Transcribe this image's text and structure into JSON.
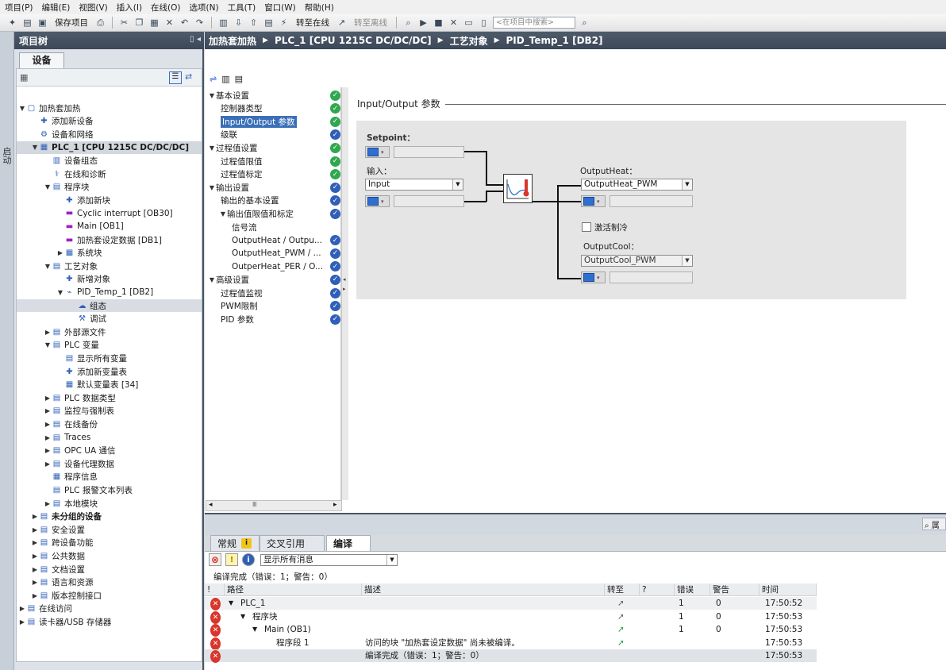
{
  "menu": [
    "项目(P)",
    "编辑(E)",
    "视图(V)",
    "插入(I)",
    "在线(O)",
    "选项(N)",
    "工具(T)",
    "窗口(W)",
    "帮助(H)"
  ],
  "toolbar": {
    "save_project": "保存项目",
    "go_online": "转至在线",
    "go_offline": "转至离线",
    "search_placeholder": "<在项目中搜索>"
  },
  "left_strip": "启动",
  "project_tree": {
    "title": "项目树",
    "devices_tab": "设备",
    "items": [
      {
        "label": "加热套加热",
        "depth": 0,
        "arrow": "down",
        "bold": false
      },
      {
        "label": "添加新设备",
        "depth": 1,
        "arrow": "",
        "bold": false
      },
      {
        "label": "设备和网络",
        "depth": 1,
        "arrow": "",
        "bold": false
      },
      {
        "label": "PLC_1 [CPU 1215C DC/DC/DC]",
        "depth": 1,
        "arrow": "down",
        "bold": true,
        "selected": true
      },
      {
        "label": "设备组态",
        "depth": 2,
        "arrow": "",
        "bold": false
      },
      {
        "label": "在线和诊断",
        "depth": 2,
        "arrow": "",
        "bold": false
      },
      {
        "label": "程序块",
        "depth": 2,
        "arrow": "down",
        "bold": false
      },
      {
        "label": "添加新块",
        "depth": 3,
        "arrow": "",
        "bold": false
      },
      {
        "label": "Cyclic interrupt [OB30]",
        "depth": 3,
        "arrow": "",
        "bold": false
      },
      {
        "label": "Main [OB1]",
        "depth": 3,
        "arrow": "",
        "bold": false
      },
      {
        "label": "加热套设定数据 [DB1]",
        "depth": 3,
        "arrow": "",
        "bold": false
      },
      {
        "label": "系统块",
        "depth": 3,
        "arrow": "right",
        "bold": false
      },
      {
        "label": "工艺对象",
        "depth": 2,
        "arrow": "down",
        "bold": false
      },
      {
        "label": "新增对象",
        "depth": 3,
        "arrow": "",
        "bold": false
      },
      {
        "label": "PID_Temp_1 [DB2]",
        "depth": 3,
        "arrow": "down",
        "bold": false
      },
      {
        "label": "组态",
        "depth": 4,
        "arrow": "",
        "bold": false,
        "selected": true
      },
      {
        "label": "调试",
        "depth": 4,
        "arrow": "",
        "bold": false
      },
      {
        "label": "外部源文件",
        "depth": 2,
        "arrow": "right",
        "bold": false
      },
      {
        "label": "PLC 变量",
        "depth": 2,
        "arrow": "down",
        "bold": false
      },
      {
        "label": "显示所有变量",
        "depth": 3,
        "arrow": "",
        "bold": false
      },
      {
        "label": "添加新变量表",
        "depth": 3,
        "arrow": "",
        "bold": false
      },
      {
        "label": "默认变量表 [34]",
        "depth": 3,
        "arrow": "",
        "bold": false
      },
      {
        "label": "PLC 数据类型",
        "depth": 2,
        "arrow": "right",
        "bold": false
      },
      {
        "label": "监控与强制表",
        "depth": 2,
        "arrow": "right",
        "bold": false
      },
      {
        "label": "在线备份",
        "depth": 2,
        "arrow": "right",
        "bold": false
      },
      {
        "label": "Traces",
        "depth": 2,
        "arrow": "right",
        "bold": false
      },
      {
        "label": "OPC UA 通信",
        "depth": 2,
        "arrow": "right",
        "bold": false
      },
      {
        "label": "设备代理数据",
        "depth": 2,
        "arrow": "right",
        "bold": false
      },
      {
        "label": "程序信息",
        "depth": 2,
        "arrow": "",
        "bold": false
      },
      {
        "label": "PLC 报警文本列表",
        "depth": 2,
        "arrow": "",
        "bold": false
      },
      {
        "label": "本地模块",
        "depth": 2,
        "arrow": "right",
        "bold": false
      },
      {
        "label": "未分组的设备",
        "depth": 1,
        "arrow": "right",
        "bold": true
      },
      {
        "label": "安全设置",
        "depth": 1,
        "arrow": "right",
        "bold": false
      },
      {
        "label": "跨设备功能",
        "depth": 1,
        "arrow": "right",
        "bold": false
      },
      {
        "label": "公共数据",
        "depth": 1,
        "arrow": "right",
        "bold": false
      },
      {
        "label": "文档设置",
        "depth": 1,
        "arrow": "right",
        "bold": false
      },
      {
        "label": "语言和资源",
        "depth": 1,
        "arrow": "right",
        "bold": false
      },
      {
        "label": "版本控制接口",
        "depth": 1,
        "arrow": "right",
        "bold": false
      },
      {
        "label": "在线访问",
        "depth": 0,
        "arrow": "right",
        "bold": false
      },
      {
        "label": "读卡器/USB 存储器",
        "depth": 0,
        "arrow": "right",
        "bold": false
      }
    ]
  },
  "breadcrumb": [
    "加热套加热",
    "PLC_1 [CPU 1215C DC/DC/DC]",
    "工艺对象",
    "PID_Temp_1 [DB2]"
  ],
  "nav": [
    {
      "label": "基本设置",
      "depth": 0,
      "arrow": "down",
      "status": "green"
    },
    {
      "label": "控制器类型",
      "depth": 1,
      "arrow": "",
      "status": "green"
    },
    {
      "label": "Input/Output 参数",
      "depth": 1,
      "arrow": "",
      "status": "green",
      "selected": true
    },
    {
      "label": "级联",
      "depth": 1,
      "arrow": "",
      "status": "blue"
    },
    {
      "label": "过程值设置",
      "depth": 0,
      "arrow": "down",
      "status": "green"
    },
    {
      "label": "过程值限值",
      "depth": 1,
      "arrow": "",
      "status": "green"
    },
    {
      "label": "过程值标定",
      "depth": 1,
      "arrow": "",
      "status": "green"
    },
    {
      "label": "输出设置",
      "depth": 0,
      "arrow": "down",
      "status": "blue"
    },
    {
      "label": "输出的基本设置",
      "depth": 1,
      "arrow": "",
      "status": "blue"
    },
    {
      "label": "输出值限值和标定",
      "depth": 1,
      "arrow": "down",
      "status": "blue"
    },
    {
      "label": "信号流",
      "depth": 2,
      "arrow": "",
      "status": ""
    },
    {
      "label": "OutputHeat / Outpu...",
      "depth": 2,
      "arrow": "",
      "status": "blue"
    },
    {
      "label": "OutputHeat_PWM / ...",
      "depth": 2,
      "arrow": "",
      "status": "blue"
    },
    {
      "label": "OutperHeat_PER / O...",
      "depth": 2,
      "arrow": "",
      "status": "blue"
    },
    {
      "label": "高级设置",
      "depth": 0,
      "arrow": "down",
      "status": "blue"
    },
    {
      "label": "过程值监视",
      "depth": 1,
      "arrow": "",
      "status": "blue"
    },
    {
      "label": "PWM限制",
      "depth": 1,
      "arrow": "",
      "status": "blue"
    },
    {
      "label": "PID 参数",
      "depth": 1,
      "arrow": "",
      "status": "blue"
    }
  ],
  "io_panel": {
    "section_title": "Input/Output 参数",
    "setpoint_label": "Setpoint：",
    "input_label": "输入：",
    "input_value": "Input",
    "output_heat_label": "OutputHeat：",
    "output_heat_value": "OutputHeat_PWM",
    "activate_cooling_label": "激活制冷",
    "output_cool_label": "OutputCool：",
    "output_cool_value": "OutputCool_PWM"
  },
  "inspector": {
    "search_label": "属",
    "tabs": [
      "常规",
      "交叉引用",
      "编译"
    ],
    "filter_value": "显示所有消息",
    "summary": "编译完成（错误：1；警告：0）",
    "columns": [
      "!",
      "路径",
      "描述",
      "转至",
      "?",
      "错误",
      "警告",
      "时间"
    ],
    "rows": [
      {
        "path": "PLC_1",
        "indent": 0,
        "arrow": "down",
        "description": "",
        "errors": "1",
        "warnings": "0",
        "time": "17:50:52"
      },
      {
        "path": "程序块",
        "indent": 1,
        "arrow": "down",
        "description": "",
        "errors": "1",
        "warnings": "0",
        "time": "17:50:53"
      },
      {
        "path": "Main (OB1)",
        "indent": 2,
        "arrow": "down",
        "description": "",
        "errors": "1",
        "warnings": "0",
        "time": "17:50:53"
      },
      {
        "path": "程序段 1",
        "indent": 3,
        "arrow": "",
        "description": "访问的块 \"加热套设定数据\" 尚未被编译。",
        "errors": "",
        "warnings": "",
        "time": "17:50:53"
      },
      {
        "path": "",
        "indent": 0,
        "arrow": "",
        "description": "编译完成（错误：1；警告：0）",
        "errors": "",
        "warnings": "",
        "time": "17:50:53"
      }
    ]
  }
}
